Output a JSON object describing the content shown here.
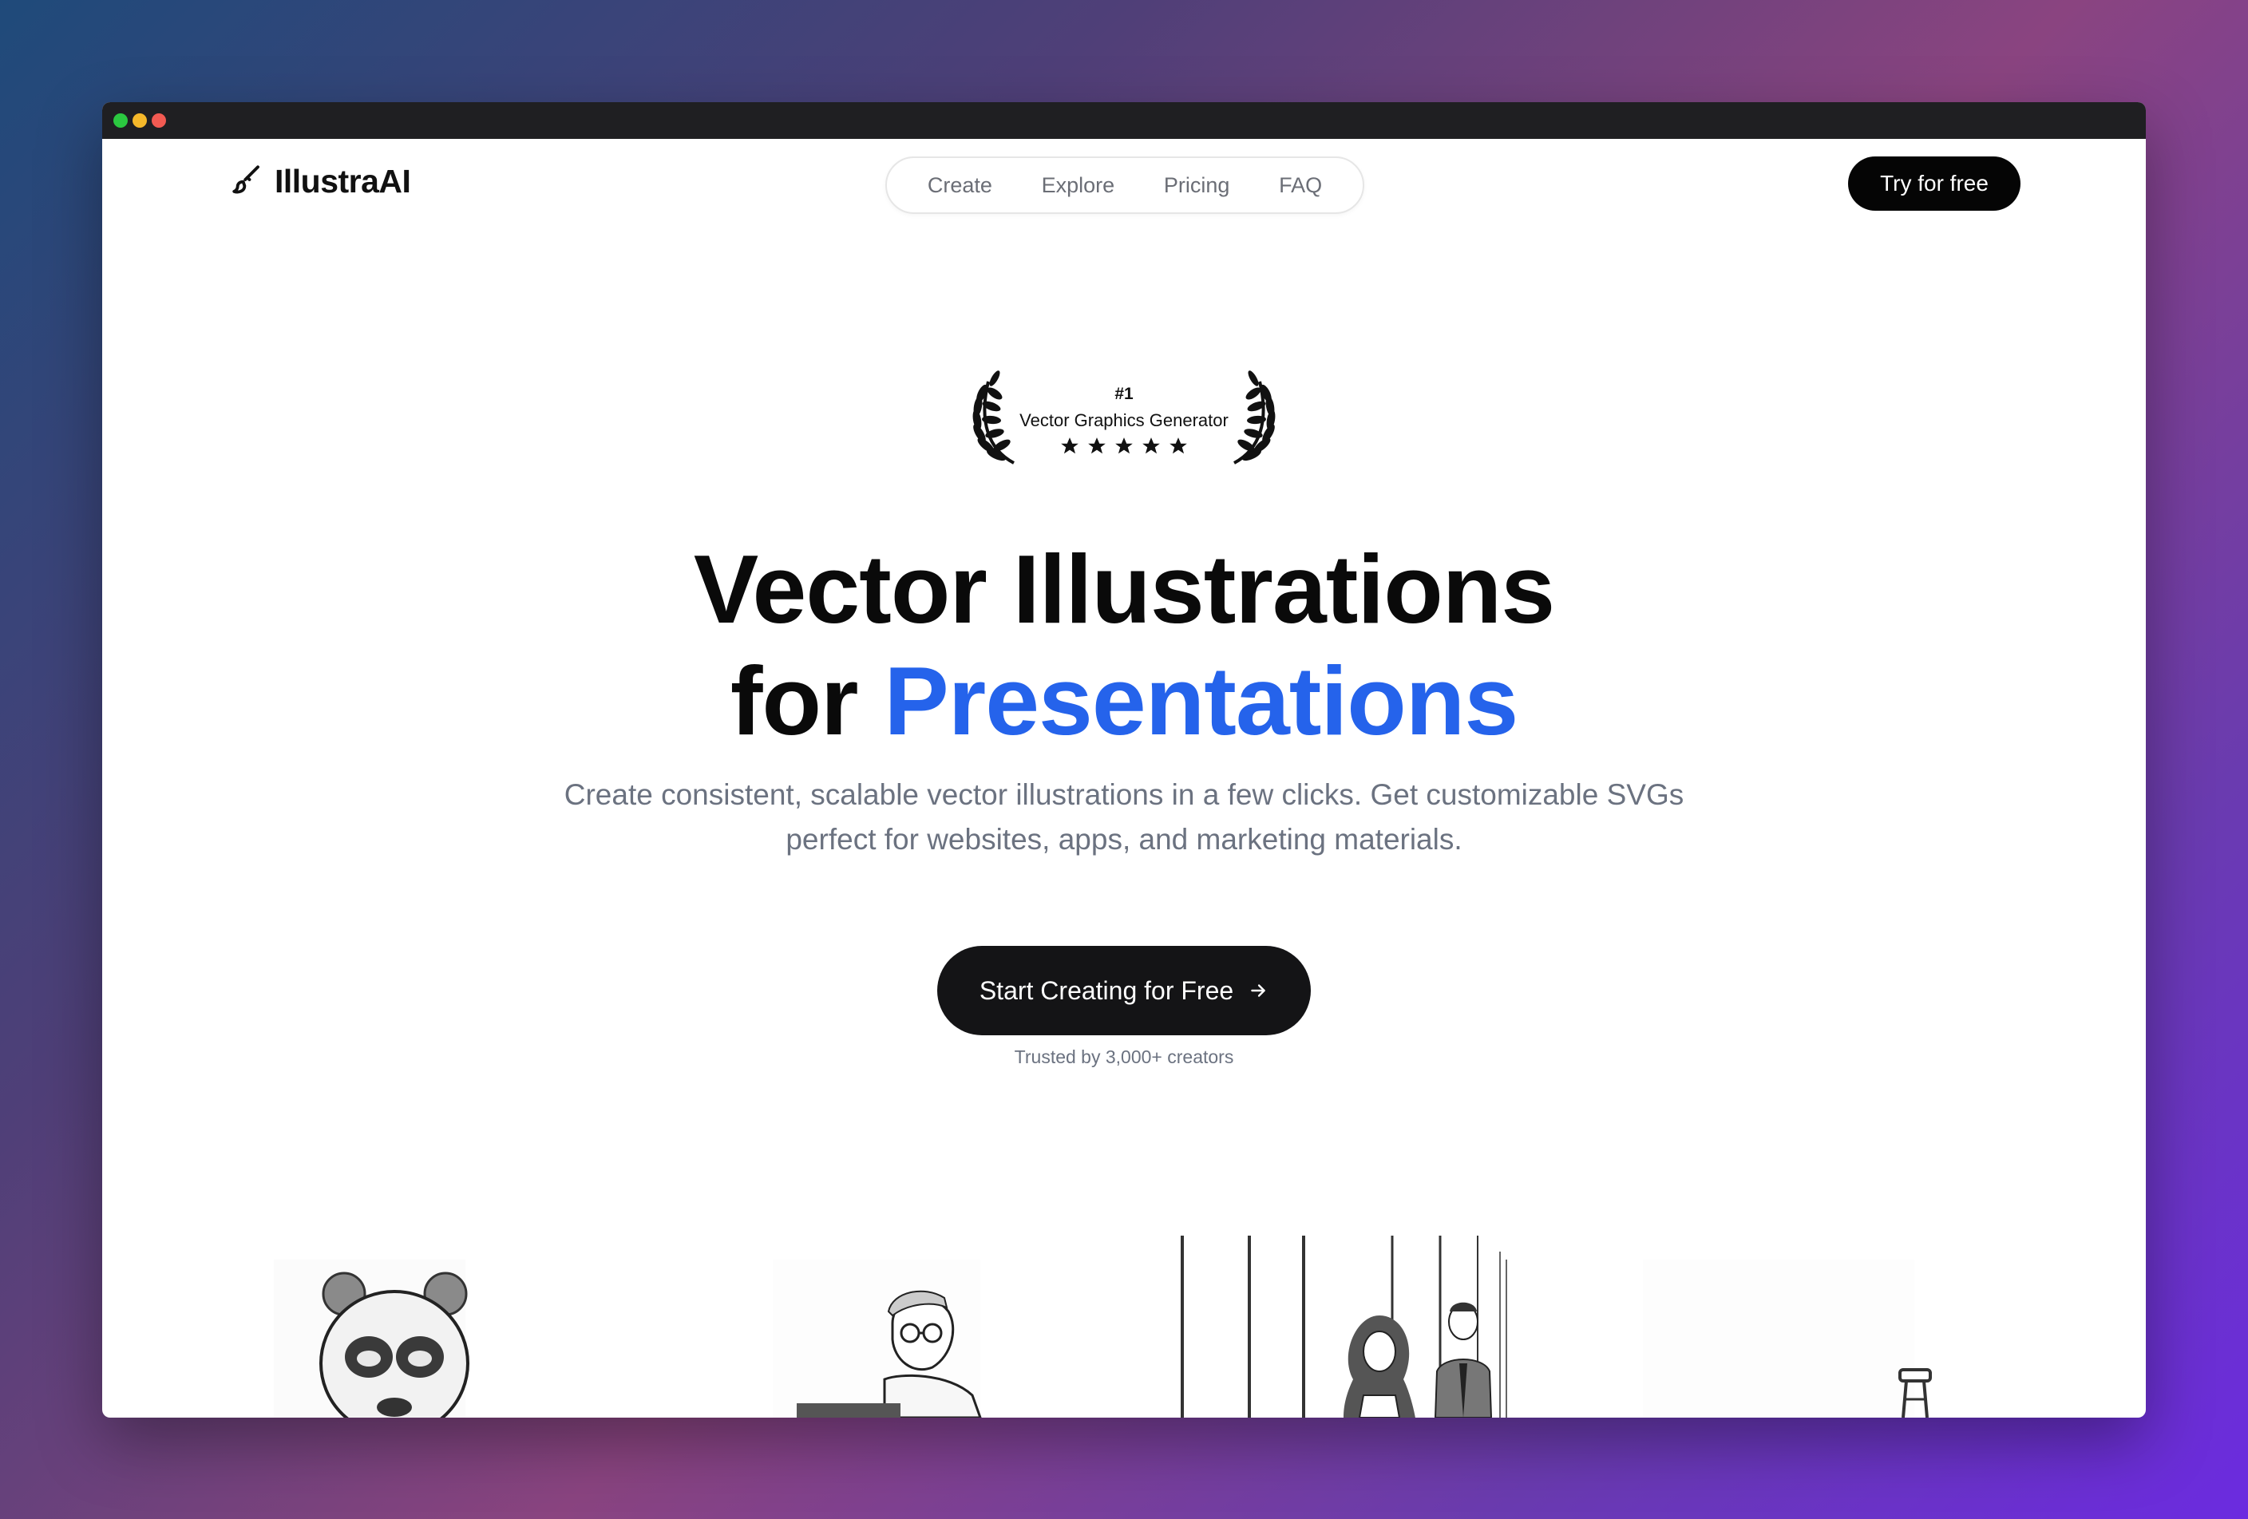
{
  "brand": {
    "name": "IllustraAI"
  },
  "nav": {
    "links": [
      "Create",
      "Explore",
      "Pricing",
      "FAQ"
    ],
    "cta_label": "Try for free"
  },
  "award": {
    "rank": "#1",
    "title": "Vector Graphics Generator",
    "rating": 5
  },
  "hero": {
    "title_line1": "Vector Illustrations",
    "title_line2_prefix": "for",
    "title_line2_accent": "Presentations",
    "subtitle_line1": "Create consistent, scalable vector illustrations in a few clicks. Get customizable SVGs",
    "subtitle_line2": "perfect for websites, apps, and marketing materials.",
    "cta_label": "Start Creating for Free",
    "trusted": "Trusted by 3,000+ creators"
  },
  "colors": {
    "accent": "#2563eb",
    "dark": "#0a0a0a"
  },
  "gallery": {
    "items": [
      "panda-illustration",
      "developer-illustration",
      "office-people-illustration",
      "stool-illustration"
    ]
  }
}
